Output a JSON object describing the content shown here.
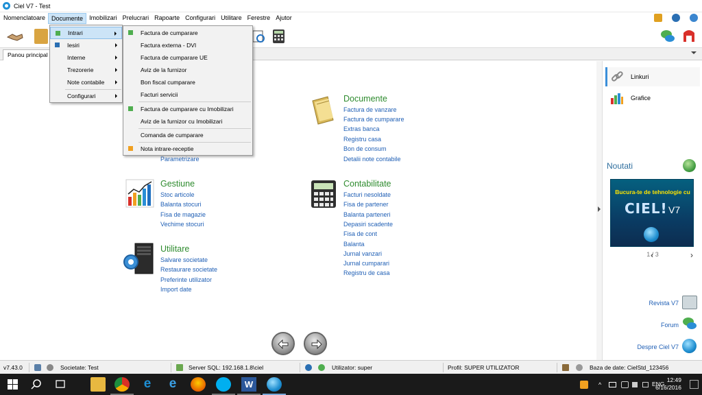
{
  "window": {
    "title": "Ciel V7 - Test"
  },
  "menubar": {
    "items": [
      "Nomenclatoare",
      "Documente",
      "Imobilizari",
      "Prelucrari",
      "Rapoarte",
      "Configurari",
      "Utilitare",
      "Ferestre",
      "Ajutor"
    ]
  },
  "tabs": {
    "main": "Panou principal"
  },
  "documente_menu": {
    "items": [
      "Intrari",
      "Iesiri",
      "Interne",
      "Trezorerie",
      "Note contabile",
      "Configurari"
    ]
  },
  "intrari_menu": {
    "items": [
      "Factura de cumparare",
      "Factura externa - DVI",
      "Factura de cumparare UE",
      "Aviz de la furnizor",
      "Bon fiscal cumparare",
      "Facturi servicii",
      "Factura de cumparare cu Imobilizari",
      "Aviz de la furnizor cu Imobilizari",
      "Comanda de cumparare",
      "Nota intrare-receptie"
    ]
  },
  "dashboard": {
    "partial_link": "Parametrizare",
    "documente": {
      "title": "Documente",
      "links": [
        "Factura de vanzare",
        "Factura de cumparare",
        "Extras banca",
        "Registru casa",
        "Bon de consum",
        "Detalii note contabile"
      ]
    },
    "gestiune": {
      "title": "Gestiune",
      "links": [
        "Stoc articole",
        "Balanta stocuri",
        "Fisa de magazie",
        "Vechime stocuri"
      ]
    },
    "contabilitate": {
      "title": "Contabilitate",
      "links": [
        "Facturi nesoldate",
        "Fisa de partener",
        "Balanta parteneri",
        "Depasiri scadente",
        "Fisa de cont",
        "Balanta",
        "Jurnal vanzari",
        "Jurnal cumparari",
        "Registru de casa"
      ]
    },
    "utilitare": {
      "title": "Utilitare",
      "links": [
        "Salvare societate",
        "Restaurare societate",
        "Preferinte utilizator",
        "Import date"
      ]
    }
  },
  "right_panel": {
    "items": [
      "Linkuri",
      "Grafice"
    ],
    "news_title": "Noutati",
    "banner_headline": "Bucura-te de tehnologie cu",
    "banner_logo": "CIEL!",
    "banner_version": "V7",
    "pager": "1 / 3",
    "links": [
      "Revista V7",
      "Forum",
      "Despre Ciel V7"
    ]
  },
  "statusbar": {
    "version": "v7.43.0",
    "societate": "Societate: Test",
    "server": "Server SQL: 192.168.1.8\\ciel",
    "utilizator": "Utilizator: super",
    "profil": "Profil: SUPER UTILIZATOR",
    "baza": "Baza de date: CielStd_123456"
  },
  "taskbar": {
    "lang": "ENG",
    "time": "12:49",
    "date": "6/16/2016"
  },
  "colors": {
    "group_title": "#2e8b2e",
    "link": "#1f5fb5",
    "menu_highlight": "#cce4f7"
  }
}
